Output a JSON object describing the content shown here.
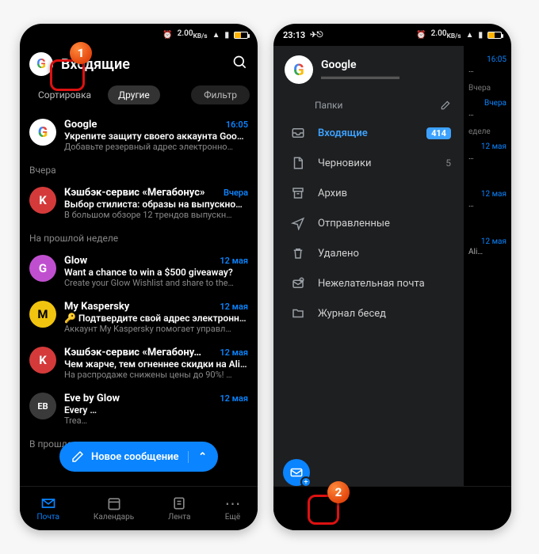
{
  "status": {
    "net": "2.00",
    "netUnit": "KB/s",
    "time2": "23:13"
  },
  "p1": {
    "title": "Входящие",
    "filters": {
      "sort": "Сортировка",
      "tab": "Другие",
      "filter": "Фильтр"
    },
    "sections": {
      "yesterday": "Вчера",
      "lastWeek": "На прошлой неделе",
      "lastMonth": "В прошлом месяце"
    },
    "msgs": [
      {
        "avBg": "#fff",
        "avTx": "",
        "avG": true,
        "sender": "Google",
        "date": "16:05",
        "subj": "Укрепите защиту своего аккаунта Goo…",
        "prev": "Добавьте резервный адрес электронно…"
      },
      {
        "avBg": "#d53a3a",
        "avTx": "K",
        "sender": "Кэшбэк-сервис «Мегабонус»",
        "date": "Вчера",
        "subj": "Выбор стилиста: образы на выпускно…",
        "prev": "В большом обзоре 12 трендов выпускн…"
      },
      {
        "avBg": "#c04fcf",
        "avTx": "G",
        "sender": "Glow",
        "date": "12 мая",
        "subj": "Want a chance to win a $500 giveaway?",
        "prev": "Create your Glow Wishlist and share to the…"
      },
      {
        "avBg": "#f1c40f",
        "avTx": "M",
        "avFg": "#000",
        "sender": "My Kaspersky",
        "date": "12 мая",
        "subj": "🔑 Подтвердите свой адрес электронн…",
        "prev": "Аккаунт My Kaspersky помогает управл…"
      },
      {
        "avBg": "#d53a3a",
        "avTx": "K",
        "sender": "Кэшбэк-сервис «Мегабону…",
        "date": "12 мая",
        "subj": "Чем жарче, тем огненнее скидки на Ali…",
        "prev": "На распродаже снижены цены до 90%! …"
      },
      {
        "avBg": "#3a3a3a",
        "avTx": "EB",
        "avFs": "11px",
        "sender": "Eve by Glow",
        "date": "12 мая",
        "subj": "Every …",
        "prev": "Trea…"
      }
    ],
    "fab": "Новое сообщение",
    "nav": {
      "mail": "Почта",
      "cal": "Календарь",
      "feed": "Лента",
      "more": "Ещё"
    }
  },
  "p2": {
    "account": "Google",
    "accountSub": "▬▬▬▬▬▬▬▬▬",
    "foldersTitle": "Папки",
    "folders": [
      {
        "icon": "inbox",
        "label": "Входящие",
        "badge": "414",
        "active": true
      },
      {
        "icon": "draft",
        "label": "Черновики",
        "count": "5"
      },
      {
        "icon": "archive",
        "label": "Архив"
      },
      {
        "icon": "sent",
        "label": "Отправленные"
      },
      {
        "icon": "trash",
        "label": "Удалено"
      },
      {
        "icon": "spam",
        "label": "Нежелательная почта"
      },
      {
        "icon": "log",
        "label": "Журнал бесед"
      }
    ],
    "peek": {
      "d1": "16:05",
      "s1": "Вчера",
      "d2": "Вчера",
      "s2": "еделе",
      "d3": "12 мая",
      "d4": "12 мая",
      "d5": "12 мая"
    }
  },
  "callouts": {
    "one": "1",
    "two": "2"
  }
}
